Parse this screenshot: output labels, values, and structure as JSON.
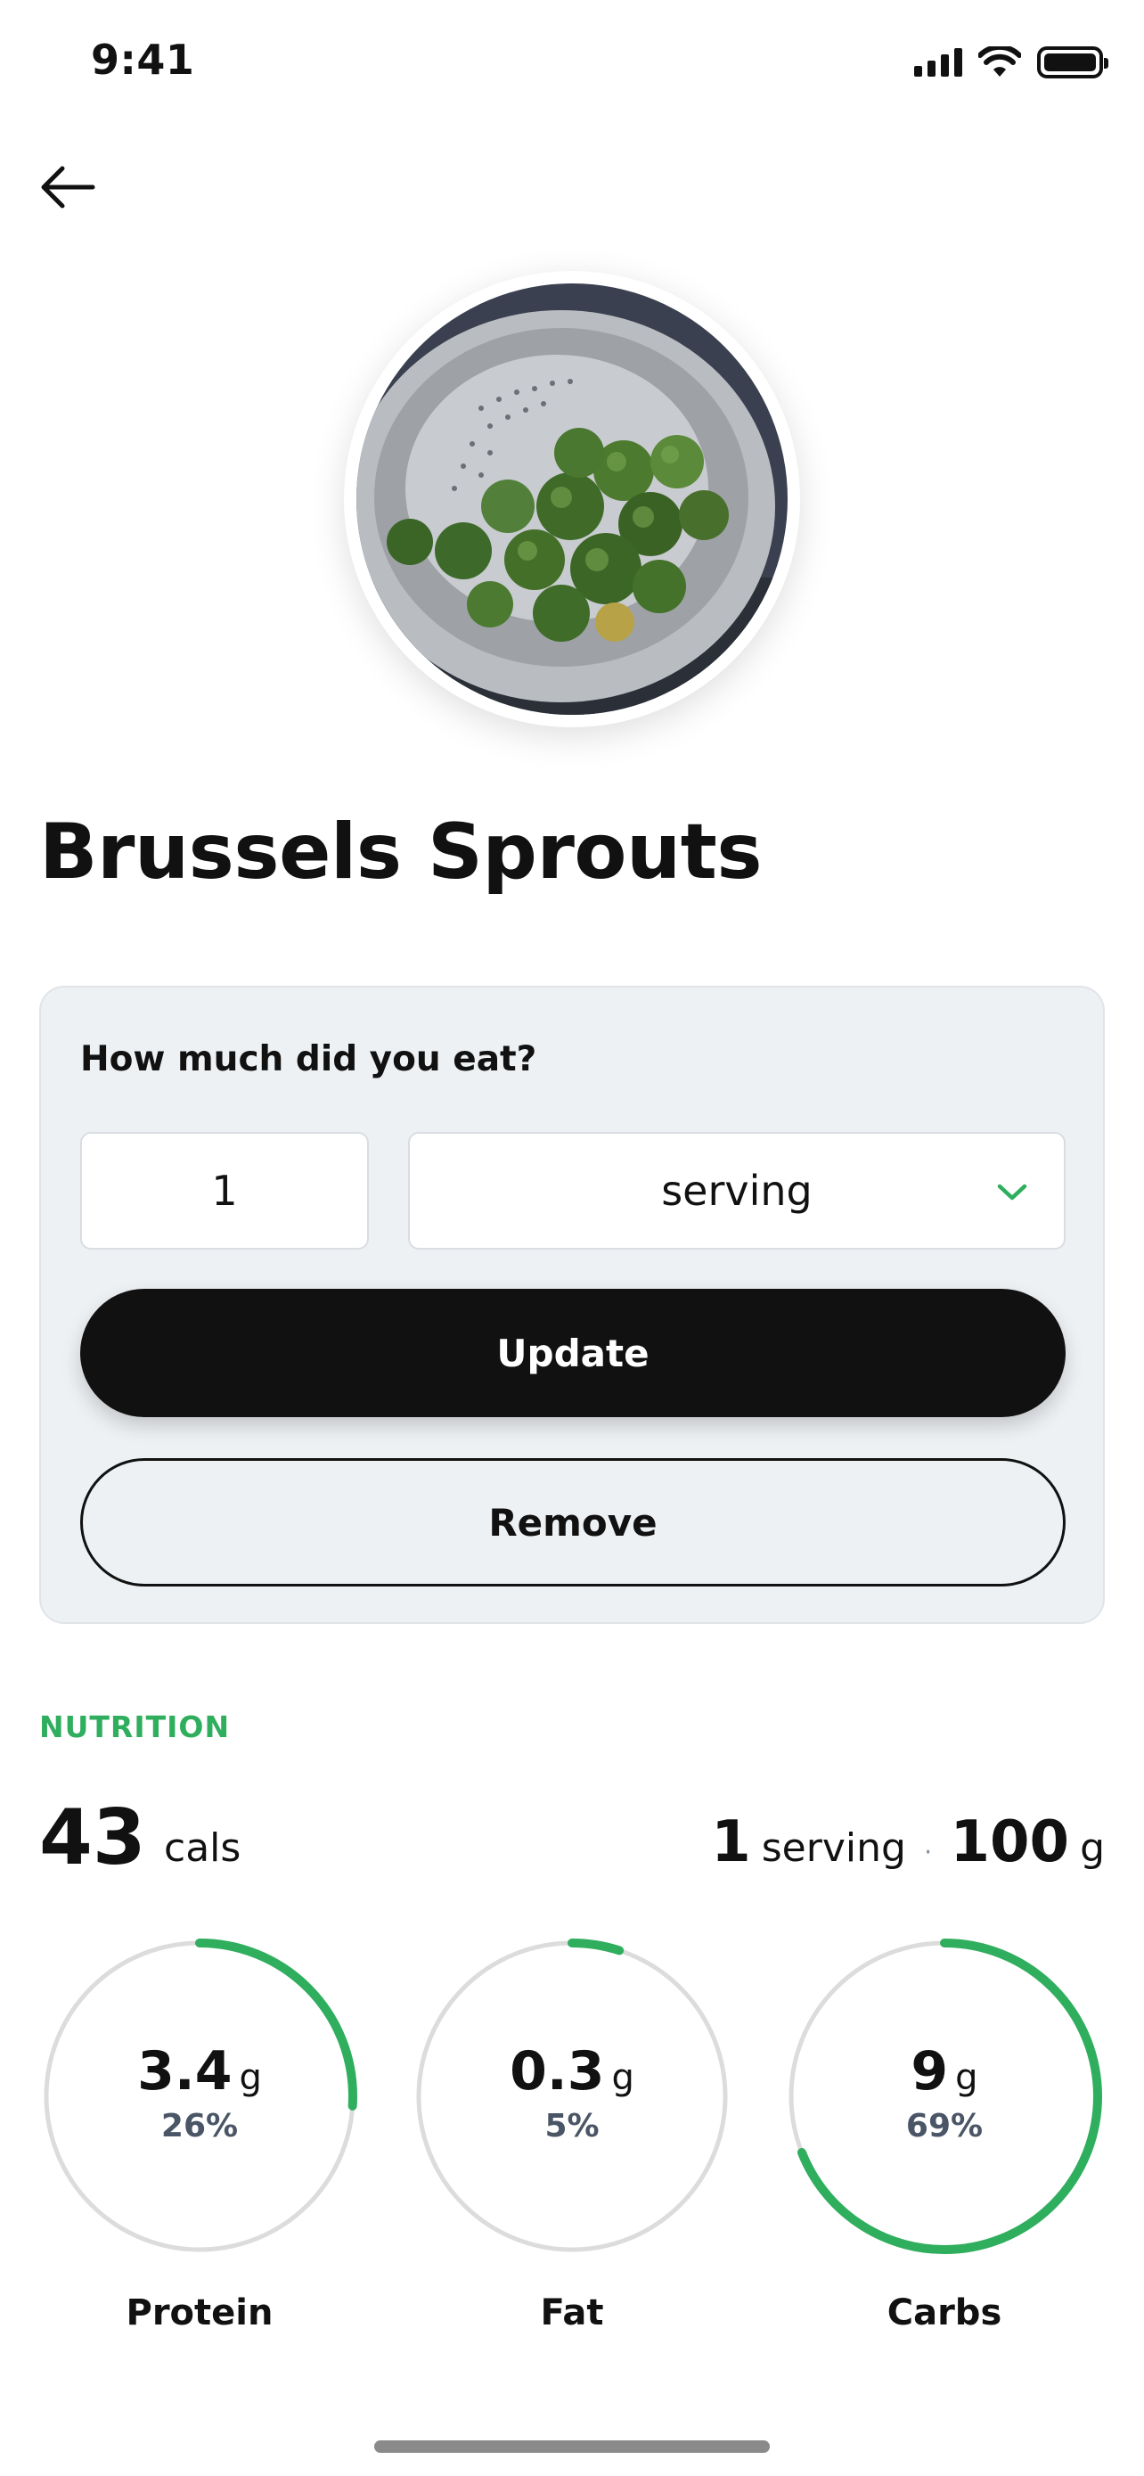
{
  "status_bar": {
    "time": "9:41"
  },
  "food": {
    "name": "Brussels Sprouts"
  },
  "portion": {
    "question": "How much did you eat?",
    "quantity": "1",
    "unit": "serving",
    "update_label": "Update",
    "remove_label": "Remove"
  },
  "nutrition": {
    "section_label": "NUTRITION",
    "calories": "43",
    "calories_unit": "cals",
    "serving_count": "1",
    "serving_unit": "serving",
    "separator": "·",
    "weight": "100",
    "weight_unit": "g",
    "macros": [
      {
        "name": "Protein",
        "amount": "3.4",
        "unit": "g",
        "percent": "26%",
        "fraction": 0.26
      },
      {
        "name": "Fat",
        "amount": "0.3",
        "unit": "g",
        "percent": "5%",
        "fraction": 0.05
      },
      {
        "name": "Carbs",
        "amount": "9",
        "unit": "g",
        "percent": "69%",
        "fraction": 0.69
      }
    ]
  },
  "colors": {
    "accent_green": "#2fae5d",
    "ring_track": "#dcdcdc",
    "card_bg": "#eef1f4",
    "primary_button": "#111111"
  },
  "icons": {
    "back": "arrow-left-icon",
    "dropdown": "chevron-down-icon",
    "signal": "cellular-signal-icon",
    "wifi": "wifi-icon",
    "battery": "battery-icon"
  }
}
